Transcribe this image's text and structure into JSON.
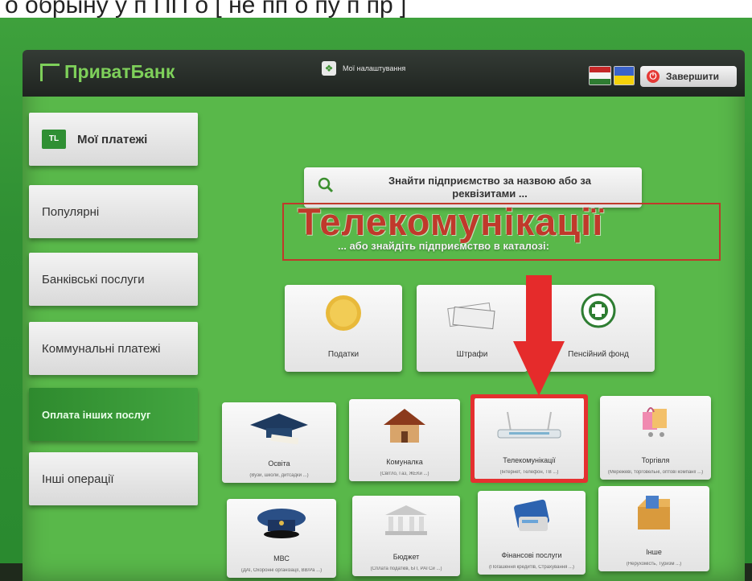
{
  "caption": "о обрыну  у п  ПП о [ не пп о пу п пр ]",
  "header": {
    "logo_text": "ПриватБанк",
    "settings_label": "Мої налаштування",
    "exit_label": "Завершити"
  },
  "sidebar": {
    "items": [
      {
        "label": "Мої платежі"
      },
      {
        "label": "Популярні"
      },
      {
        "label": "Банківські послуги"
      },
      {
        "label": "Коммунальні платежі"
      },
      {
        "label": "Оплата інших послуг"
      },
      {
        "label": "Інші операції"
      }
    ]
  },
  "search": {
    "placeholder": "Знайти підприємство за назвою або за реквізитами ..."
  },
  "overlay": {
    "title": "Телекомунікації",
    "catalog_hint": "... або знайдіть підприємство в каталозі:"
  },
  "top_tiles": [
    {
      "label": "Податки"
    },
    {
      "label": "Штрафи"
    },
    {
      "label": "Пенсійний фонд"
    }
  ],
  "tiles_row1": [
    {
      "label": "Освіта",
      "sub": "(Вузи, школи, дитсадки ...)"
    },
    {
      "label": "Комуналка",
      "sub": "(Світло, Газ, ЖЕКи ...)"
    },
    {
      "label": "Телекомунікації",
      "sub": "(Інтернет, Телефон, ТВ ...)"
    },
    {
      "label": "Торгівля",
      "sub": "(Мережеві, торговельні, оптові компанії ...)"
    }
  ],
  "tiles_row2": [
    {
      "label": "МВС",
      "sub": "(ДАІ, Охоронні організації, ВВ/Ра ...)"
    },
    {
      "label": "Бюджет",
      "sub": "(Сплата податків, БП, РАГСи ...)"
    },
    {
      "label": "Фінансові послуги",
      "sub": "(Погашення кредитів, Страхування ...)"
    },
    {
      "label": "Інше",
      "sub": "(Нерухомість, Туризм ...)"
    }
  ],
  "colors": {
    "accent": "#59b84a",
    "highlight": "#e53030",
    "overlay_text": "#c0392b"
  }
}
